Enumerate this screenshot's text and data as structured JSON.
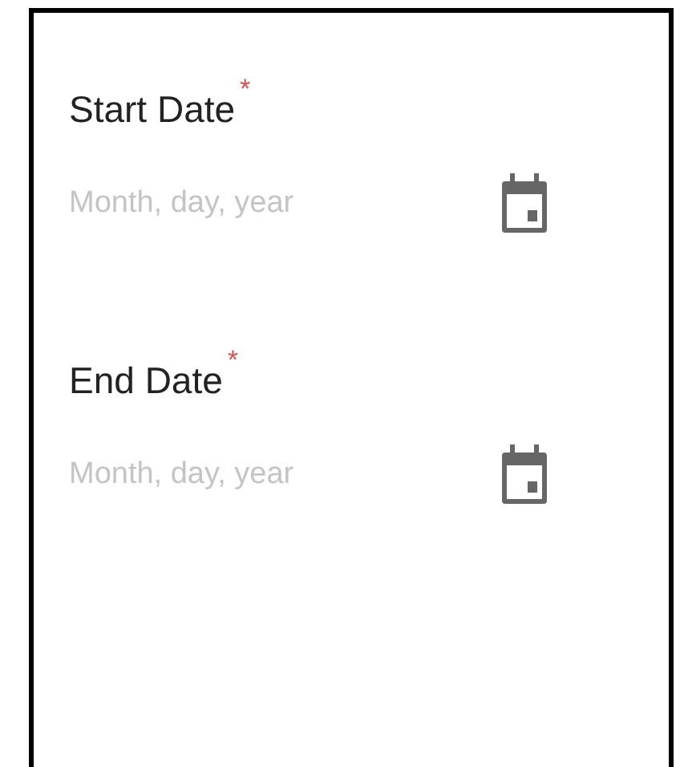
{
  "fields": [
    {
      "label": "Start Date",
      "required_mark": "*",
      "placeholder": "Month, day, year"
    },
    {
      "label": "End Date",
      "required_mark": "*",
      "placeholder": "Month, day, year"
    }
  ]
}
